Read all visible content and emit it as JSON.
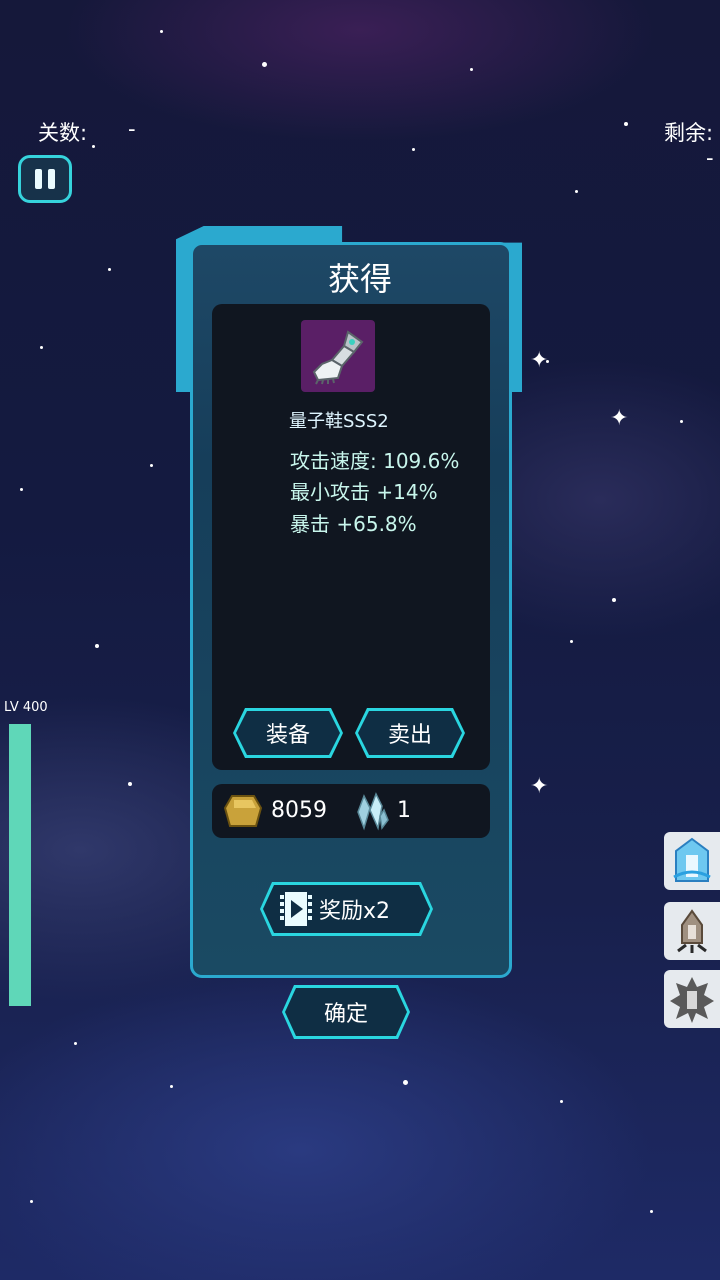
{
  "hud": {
    "level_label": "关数:",
    "level_value": "-",
    "remaining_label": "剩余:",
    "remaining_value": "-",
    "lv_label": "LV 400"
  },
  "dialog": {
    "title": "获得",
    "item_name": "量子鞋SSS2",
    "stats": [
      "攻击速度: 109.6%",
      "最小攻击 +14%",
      "暴击 +65.8%"
    ],
    "equip_label": "装备",
    "sell_label": "卖出",
    "gold_value": "8059",
    "crystal_value": "1",
    "reward_label": "奖励x2",
    "confirm_label": "确定"
  },
  "icons": {
    "pause": "pause-icon",
    "item": "gauntlet-icon",
    "gold": "gold-nugget-icon",
    "crystal": "crystal-icon",
    "video": "video-play-icon",
    "side": [
      "skill-shield-icon",
      "skill-rocket-icon",
      "skill-explosion-icon"
    ]
  },
  "colors": {
    "accent": "#2ad6e0",
    "panel": "#101620",
    "stat_text": "#c8f6ec",
    "lv_bar": "#5fd7b8",
    "item_bg": "#5a1f66"
  },
  "level_progress": 1.0
}
